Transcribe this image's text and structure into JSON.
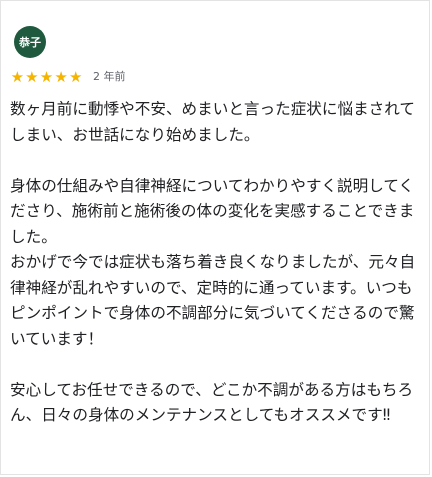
{
  "reviewer": {
    "name": "恭子"
  },
  "rating": {
    "stars": 5,
    "max": 5,
    "star_color": "#f5b400"
  },
  "time_ago": "2 年前",
  "review_paragraphs": [
    "数ヶ月前に動悸や不安、めまいと言った症状に悩まされてしまい、お世話になり始めました。",
    "",
    "身体の仕組みや自律神経についてわかりやすく説明してくださり、施術前と施術後の体の変化を実感することできました。",
    "おかげで今では症状も落ち着き良くなりましたが、元々自律神経が乱れやすいので、定時的に通っています。いつもピンポイントで身体の不調部分に気づいてくださるので驚いています！",
    "",
    "安心してお任せできるので、どこか不調がある方はもちろん、日々の身体のメンテナンスとしてもオススメです‼"
  ]
}
